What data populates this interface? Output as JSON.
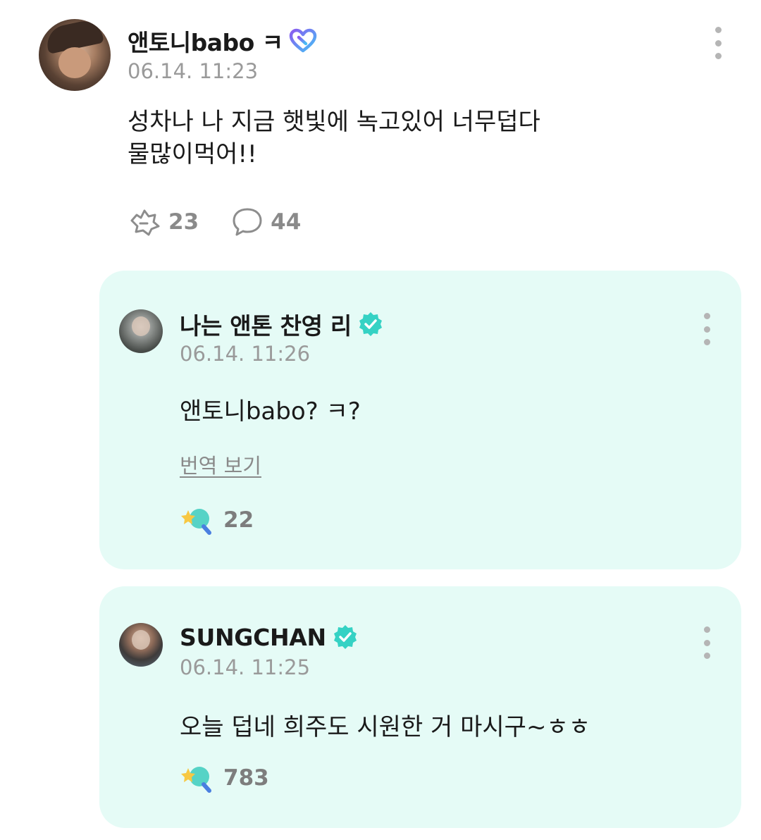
{
  "post": {
    "author": "앤토니babo ㅋ",
    "timestamp": "06.14. 11:23",
    "body_lines": [
      "성차나 나 지금 햇빛에 녹고있어 너무덥다",
      "물많이먹어!!"
    ],
    "reactions": {
      "cheer_count": "23",
      "comment_count": "44"
    },
    "icons": {
      "heart_badge": "heart-badge-icon",
      "more": "more-vertical-icon",
      "cheer": "cheer-icon",
      "comment": "comment-bubble-icon"
    }
  },
  "comments": [
    {
      "author": "나는 앤톤 찬영 리",
      "verified": true,
      "timestamp": "06.14. 11:26",
      "body": "앤토니babo? ㅋ?",
      "translate_label": "번역 보기",
      "like_count": "22"
    },
    {
      "author": "SUNGCHAN",
      "verified": true,
      "timestamp": "06.14. 11:25",
      "body": "오늘 덥네 희주도 시원한 거 마시구~ㅎㅎ",
      "like_count": "783"
    }
  ],
  "colors": {
    "card_background": "#e5fbf6",
    "verified_badge": "#35d2c4",
    "heart_gradient_start": "#7c6cf2",
    "heart_gradient_end": "#4fb8f5",
    "meta_text": "#9a9a9a"
  }
}
